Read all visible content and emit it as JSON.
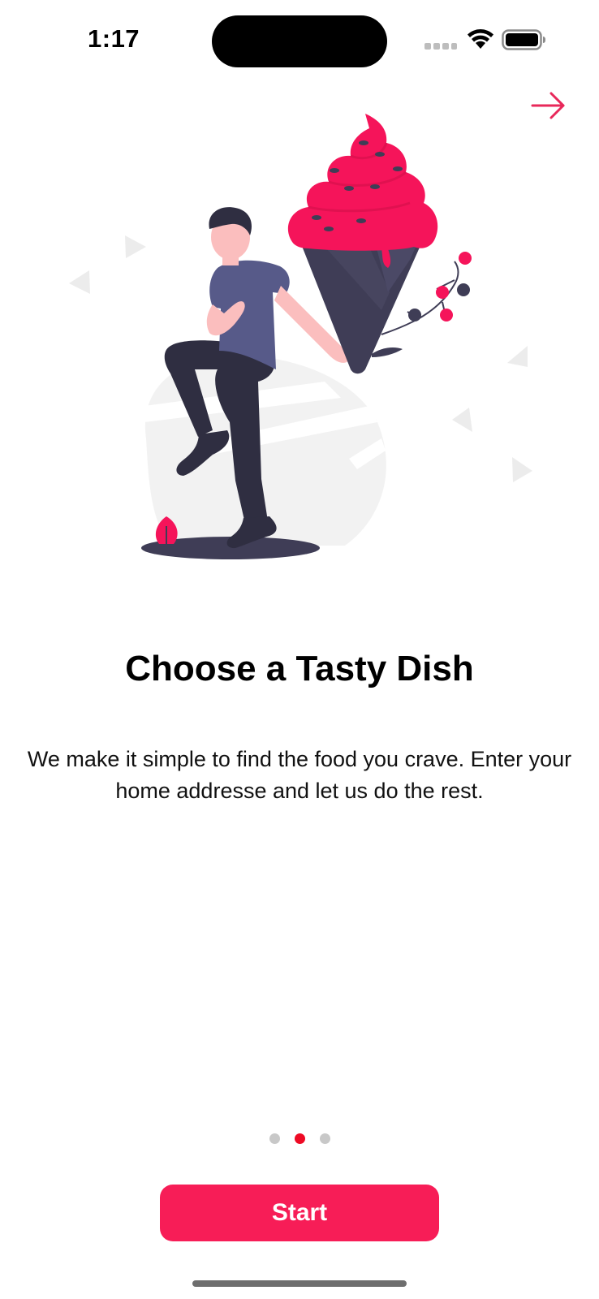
{
  "status_bar": {
    "time": "1:17"
  },
  "onboarding": {
    "title": "Choose a Tasty Dish",
    "description": "We make it simple to find the food you crave. Enter your  home addresse and let us do the rest.",
    "illustration_icon": "man-with-ice-cream-illustration",
    "skip_icon": "arrow-right-icon"
  },
  "pagination": {
    "total_pages": 3,
    "current_page": 2
  },
  "actions": {
    "start_label": "Start"
  },
  "colors": {
    "accent": "#f71d57",
    "active_dot": "#ee0a24",
    "inactive_dot": "#c8c8c8"
  }
}
